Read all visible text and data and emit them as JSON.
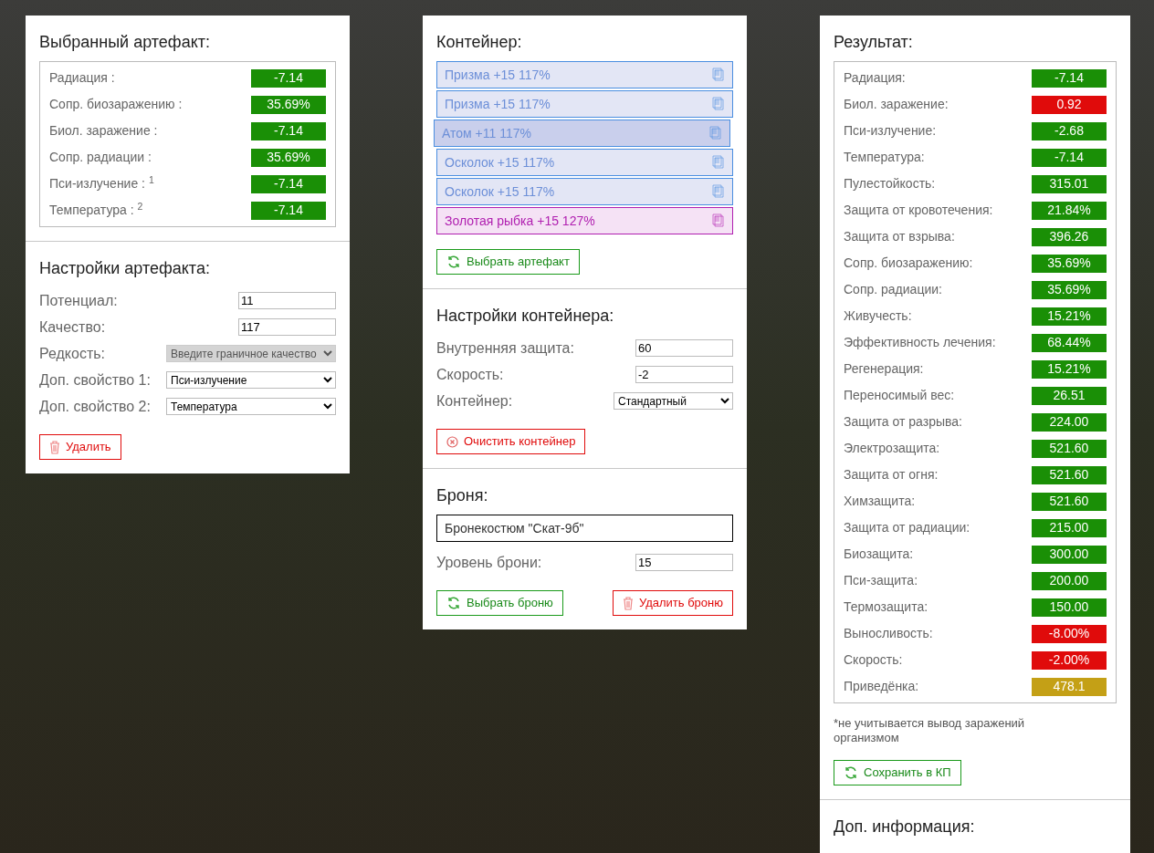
{
  "artifact": {
    "title": "Выбранный артефакт:",
    "stats": [
      {
        "label": "Радиация :",
        "value": "-7.14",
        "color": "#1a8f06"
      },
      {
        "label": "Сопр. биозаражению :",
        "value": "35.69%",
        "color": "#1a8f06"
      },
      {
        "label": "Биол. заражение :",
        "value": "-7.14",
        "color": "#1a8f06"
      },
      {
        "label": "Сопр. радиации :",
        "value": "35.69%",
        "color": "#1a8f06"
      },
      {
        "label": "Пси-излучение : $^{1}$",
        "value": "-7.14",
        "color": "#1a8f06"
      },
      {
        "label": "Температура : $^{2}$",
        "value": "-7.14",
        "color": "#1a8f06"
      }
    ]
  },
  "artifact_settings": {
    "title": "Настройки артефакта:",
    "fields": [
      {
        "kind": "input",
        "label": "Потенциал:",
        "value": "11"
      },
      {
        "kind": "input",
        "label": "Качество:",
        "value": "117"
      },
      {
        "kind": "select",
        "label": "Редкость:",
        "value": "Введите граничное качество",
        "disabled": true
      },
      {
        "kind": "select",
        "label": "Доп. свойство 1:",
        "value": "Пси-излучение",
        "disabled": false
      },
      {
        "kind": "select",
        "label": "Доп. свойство 2:",
        "value": "Температура",
        "disabled": false
      }
    ],
    "buttons": [
      {
        "kind": "delete",
        "label": "Удалить"
      }
    ]
  },
  "container": {
    "title": "Контейнер:",
    "items": [
      {
        "label": "Призма +15 117%",
        "color": "#4a8ee0",
        "selected": false
      },
      {
        "label": "Призма +15 117%",
        "color": "#4a8ee0",
        "selected": false
      },
      {
        "label": "Атом +11 117%",
        "color": "#4a8ee0",
        "selected": true
      },
      {
        "label": "Осколок +15 117%",
        "color": "#4a8ee0",
        "selected": false
      },
      {
        "label": "Осколок +15 117%",
        "color": "#4a8ee0",
        "selected": false
      },
      {
        "label": "Золотая рыбка +15 127%",
        "color": "#b01fb0",
        "selected": false
      }
    ],
    "buttons": [
      {
        "kind": "choose",
        "label": "Выбрать артефакт"
      }
    ]
  },
  "container_settings": {
    "title": "Настройки контейнера:",
    "fields": [
      {
        "kind": "input",
        "label": "Внутренняя защита:",
        "value": "60"
      },
      {
        "kind": "input",
        "label": "Скорость:",
        "value": "-2"
      },
      {
        "kind": "select",
        "label": "Контейнер:",
        "value": "Стандартный",
        "disabled": false
      }
    ],
    "buttons": [
      {
        "kind": "clear",
        "label": "Очистить контейнер"
      }
    ]
  },
  "armor": {
    "title": "Броня:",
    "name": "Бронекостюм \"Скат-9б\"",
    "fields": [
      {
        "kind": "input",
        "label": "Уровень брони:",
        "value": "15"
      }
    ],
    "buttons": [
      {
        "kind": "choose",
        "label": "Выбрать броню"
      },
      {
        "kind": "delete",
        "label": "Удалить броню"
      }
    ]
  },
  "result": {
    "title": "Результат:",
    "stats": [
      {
        "label": "Радиация:",
        "value": "-7.14",
        "color": "#1a8f06"
      },
      {
        "label": "Биол. заражение:",
        "value": "0.92",
        "color": "#e00b0b"
      },
      {
        "label": "Пси-излучение:",
        "value": "-2.68",
        "color": "#1a8f06"
      },
      {
        "label": "Температура:",
        "value": "-7.14",
        "color": "#1a8f06"
      },
      {
        "label": "Пулестойкость:",
        "value": "315.01",
        "color": "#1a8f06"
      },
      {
        "label": "Защита от кровотечения:",
        "value": "21.84%",
        "color": "#1a8f06"
      },
      {
        "label": "Защита от взрыва:",
        "value": "396.26",
        "color": "#1a8f06"
      },
      {
        "label": "Сопр. биозаражению:",
        "value": "35.69%",
        "color": "#1a8f06"
      },
      {
        "label": "Сопр. радиации:",
        "value": "35.69%",
        "color": "#1a8f06"
      },
      {
        "label": "Живучесть:",
        "value": "15.21%",
        "color": "#1a8f06"
      },
      {
        "label": "Эффективность лечения:",
        "value": "68.44%",
        "color": "#1a8f06"
      },
      {
        "label": "Регенерация:",
        "value": "15.21%",
        "color": "#1a8f06"
      },
      {
        "label": "Переносимый вес:",
        "value": "26.51",
        "color": "#1a8f06"
      },
      {
        "label": "Защита от разрыва:",
        "value": "224.00",
        "color": "#1a8f06"
      },
      {
        "label": "Электрозащита:",
        "value": "521.60",
        "color": "#1a8f06"
      },
      {
        "label": "Защита от огня:",
        "value": "521.60",
        "color": "#1a8f06"
      },
      {
        "label": "Химзащита:",
        "value": "521.60",
        "color": "#1a8f06"
      },
      {
        "label": "Защита от радиации:",
        "value": "215.00",
        "color": "#1a8f06"
      },
      {
        "label": "Биозащита:",
        "value": "300.00",
        "color": "#1a8f06"
      },
      {
        "label": "Пси-защита:",
        "value": "200.00",
        "color": "#1a8f06"
      },
      {
        "label": "Термозащита:",
        "value": "150.00",
        "color": "#1a8f06"
      },
      {
        "label": "Выносливость:",
        "value": "-8.00%",
        "color": "#e00b0b"
      },
      {
        "label": "Скорость:",
        "value": "-2.00%",
        "color": "#e00b0b"
      },
      {
        "label": "Приведёнка:",
        "value": "478.1",
        "color": "#c4a016"
      }
    ],
    "note": "*не учитывается вывод заражений организмом",
    "buttons": [
      {
        "kind": "choose",
        "label": "Сохранить в КП"
      }
    ]
  },
  "extra": {
    "title": "Доп. информация:"
  }
}
